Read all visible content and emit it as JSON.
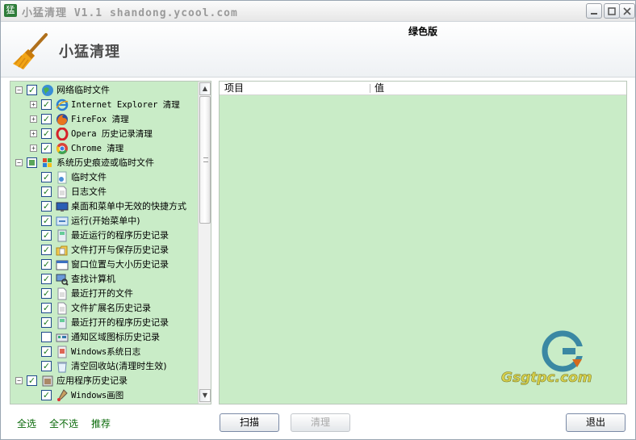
{
  "window": {
    "title": "小猛清理 V1.1 shandong.ycool.com",
    "app_icon_char": "猛"
  },
  "header": {
    "edition": "绿色版",
    "app_title": "小猛清理"
  },
  "tree": {
    "items": [
      {
        "label": "网络临时文件",
        "level": 0,
        "expander": "−",
        "check": "checked",
        "icon": "globe-icon"
      },
      {
        "label": "Internet Explorer 清理",
        "level": 1,
        "expander": "+",
        "check": "checked",
        "icon": "internet-explorer-icon",
        "mono": true
      },
      {
        "label": "FireFox 清理",
        "level": 1,
        "expander": "+",
        "check": "checked",
        "icon": "firefox-icon",
        "mono": true
      },
      {
        "label": "Opera 历史记录清理",
        "level": 1,
        "expander": "+",
        "check": "checked",
        "icon": "opera-icon",
        "mono": true
      },
      {
        "label": "Chrome 清理",
        "level": 1,
        "expander": "+",
        "check": "checked",
        "icon": "chrome-icon",
        "mono": true
      },
      {
        "label": "系统历史痕迹或临时文件",
        "level": 0,
        "expander": "−",
        "check": "partial",
        "icon": "windows-icon"
      },
      {
        "label": "临时文件",
        "level": 1,
        "check": "checked",
        "icon": "temp-file-icon"
      },
      {
        "label": "日志文件",
        "level": 1,
        "check": "checked",
        "icon": "document-icon"
      },
      {
        "label": "桌面和菜单中无效的快捷方式",
        "level": 1,
        "check": "checked",
        "icon": "desktop-icon"
      },
      {
        "label": "运行(开始菜单中)",
        "level": 1,
        "check": "checked",
        "icon": "run-icon"
      },
      {
        "label": "最近运行的程序历史记录",
        "level": 1,
        "check": "checked",
        "icon": "program-icon"
      },
      {
        "label": "文件打开与保存历史记录",
        "level": 1,
        "check": "checked",
        "icon": "folder-file-icon"
      },
      {
        "label": "窗口位置与大小历史记录",
        "level": 1,
        "check": "checked",
        "icon": "window-icon"
      },
      {
        "label": "查找计算机",
        "level": 1,
        "check": "checked",
        "icon": "find-computer-icon"
      },
      {
        "label": "最近打开的文件",
        "level": 1,
        "check": "checked",
        "icon": "document-icon"
      },
      {
        "label": "文件扩展名历史记录",
        "level": 1,
        "check": "checked",
        "icon": "document-icon"
      },
      {
        "label": "最近打开的程序历史记录",
        "level": 1,
        "check": "checked",
        "icon": "program-icon"
      },
      {
        "label": "通知区域图标历史记录",
        "level": 1,
        "check": "unchecked",
        "icon": "tray-icon"
      },
      {
        "label": "Windows系统日志",
        "level": 1,
        "check": "checked",
        "icon": "system-log-icon",
        "mono": true
      },
      {
        "label": "清空回收站(清理时生效)",
        "level": 1,
        "check": "checked",
        "icon": "recycle-bin-icon"
      },
      {
        "label": "应用程序历史记录",
        "level": 0,
        "expander": "−",
        "check": "checked",
        "icon": "application-icon"
      },
      {
        "label": "Windows画图",
        "level": 1,
        "check": "checked",
        "icon": "paint-icon",
        "mono": true
      }
    ]
  },
  "list": {
    "columns": [
      "项目",
      "值"
    ],
    "watermark": "Gsgtpc.com"
  },
  "footer": {
    "select_all": "全选",
    "select_none": "全不选",
    "recommended": "推荐",
    "scan_button": "扫描",
    "clean_button": "清理",
    "exit_button": "退出"
  },
  "colors": {
    "panel_green": "#c9ecc7",
    "link_green": "#0a6a0a"
  }
}
